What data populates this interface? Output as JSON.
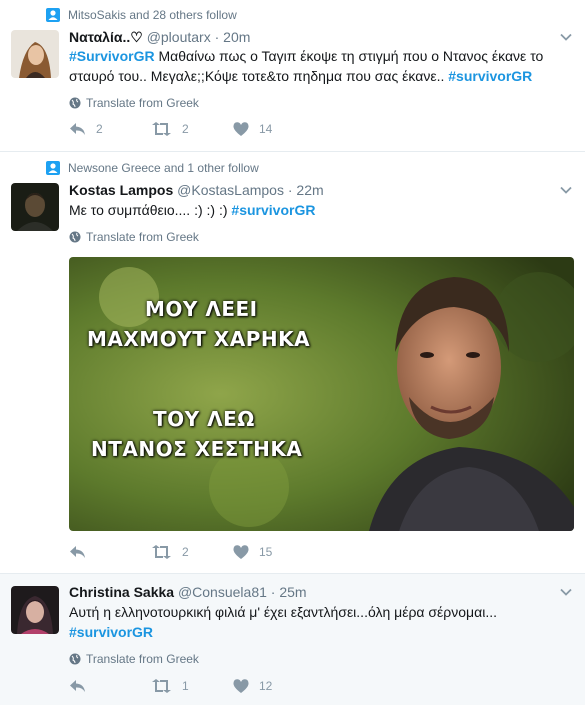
{
  "tweets": [
    {
      "context": "MitsoSakis and 28 others follow",
      "name": "Ναταλία..♡",
      "handle": "@ploutarx",
      "time": "20m",
      "segments": [
        {
          "tag": "#SurvivorGR"
        },
        {
          "text": " Μαθαίνω πως ο Ταγιπ έκοψε τη στιγμή που ο Ντανος έκανε το σταυρό του.. Μεγαλε;;Κόψε τοτε&το πηδημα που σας έκανε.. "
        },
        {
          "tag": "#survivorGR"
        }
      ],
      "translate": "Translate from Greek",
      "replies": "2",
      "retweets": "2",
      "likes": "14"
    },
    {
      "context": "Newsone Greece and 1 other follow",
      "name": "Kostas Lampos",
      "handle": "@KostasLampos",
      "time": "22m",
      "segments": [
        {
          "text": "Με το συμπάθειο....  :) :) :)  "
        },
        {
          "tag": "#survivorGR"
        }
      ],
      "translate": "Translate from Greek",
      "media_caption": {
        "line1": "ΜΟΥ ΛΕΕΙ",
        "line2": "ΜΑΧΜΟΥΤ ΧΑΡΗΚΑ",
        "line3": "ΤΟΥ ΛΕΩ",
        "line4": "ΝΤΑΝΟΣ ΧΕΣΤΗΚΑ"
      },
      "replies": "",
      "retweets": "2",
      "likes": "15"
    },
    {
      "context": "",
      "name": "Christina Sakka",
      "handle": "@Consuela81",
      "time": "25m",
      "segments": [
        {
          "text": "Αυτή η ελληνοτουρκική φιλιά μ' έχει εξαντλήσει...όλη μέρα σέρνομαι... "
        },
        {
          "tag": "#survivorGR"
        }
      ],
      "translate": "Translate from Greek",
      "replies": "",
      "retweets": "1",
      "likes": "12"
    }
  ],
  "colors": {
    "link": "#1b95e0",
    "muted": "#657786",
    "action": "#8899a6",
    "context_icon": "#1da1f2"
  },
  "icons": {
    "context": "follow-person-icon",
    "chevron": "chevron-down-icon",
    "translate": "globe-icon",
    "reply": "reply-icon",
    "retweet": "retweet-icon",
    "like": "heart-icon"
  }
}
